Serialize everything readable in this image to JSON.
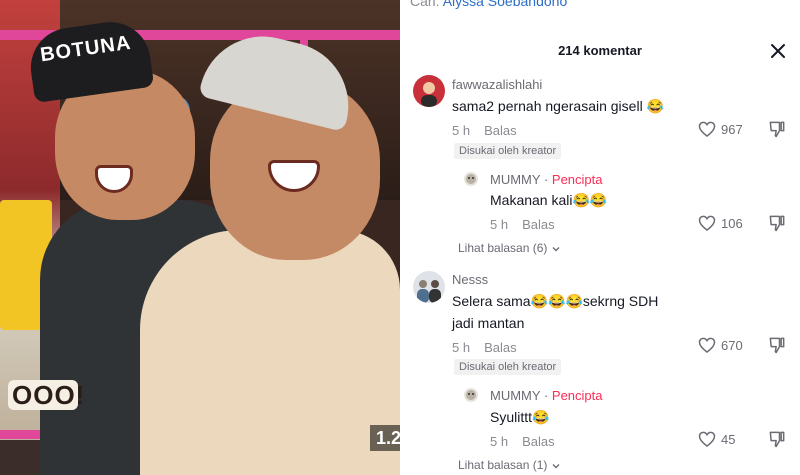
{
  "caption": {
    "prefix": "Cari:",
    "query": "Alyssa Soebandono"
  },
  "video": {
    "cap_text": "BOTUNA",
    "overlay_text": "OOO!",
    "speed": "1.2"
  },
  "comments_header": {
    "count_label": "214 komentar"
  },
  "comments": [
    {
      "username": "fawwazalishlahi",
      "text": "sama2 pernah ngerasain gisell 😂",
      "time": "5 h",
      "reply_label": "Balas",
      "likes": "967",
      "liked_by_creator": "Disukai oleh kreator",
      "reply": {
        "username": "MUMMY",
        "separator": "·",
        "creator_label": "Pencipta",
        "text": "Makanan kali😂😂",
        "time": "5 h",
        "reply_label": "Balas",
        "likes": "106"
      },
      "view_replies": "Lihat balasan (6)"
    },
    {
      "username": "Nesss",
      "text": "Selera sama😂😂😂sekrng SDH jadi mantan",
      "time": "5 h",
      "reply_label": "Balas",
      "likes": "670",
      "liked_by_creator": "Disukai oleh kreator",
      "reply": {
        "username": "MUMMY",
        "separator": "·",
        "creator_label": "Pencipta",
        "text": "Syulittt😂",
        "time": "5 h",
        "reply_label": "Balas",
        "likes": "45"
      },
      "view_replies": "Lihat balasan (1)"
    }
  ],
  "colors": {
    "creator": "#fe2c55",
    "accent_pink": "#e0479a",
    "link_blue": "#2d6dc5"
  },
  "icons": [
    "close-icon",
    "heart-icon",
    "dislike-icon",
    "chevron-down-icon"
  ]
}
